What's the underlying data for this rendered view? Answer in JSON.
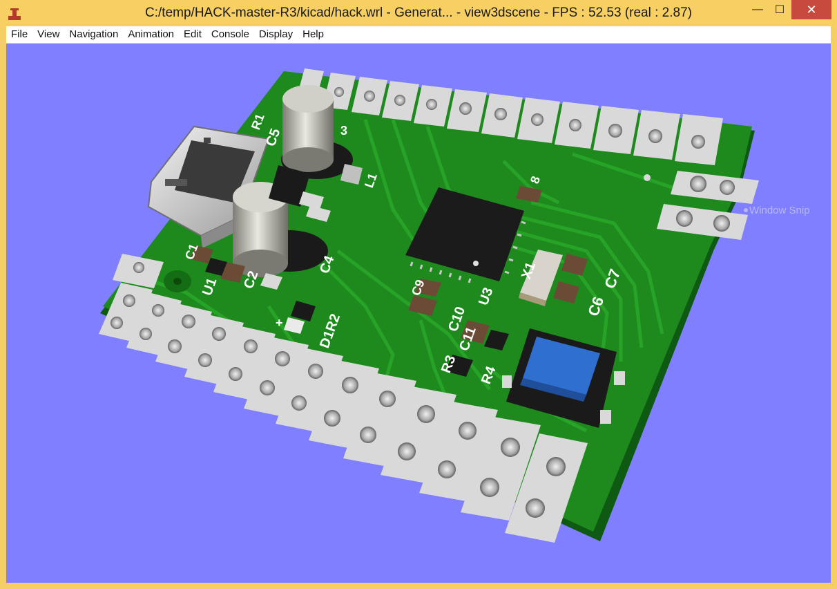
{
  "window": {
    "title": "C:/temp/HACK-master-R3/kicad/hack.wrl - Generat... - view3dscene - FPS : 52.53 (real : 2.87)",
    "min_glyph": "—",
    "max_glyph": "☐",
    "close_glyph": "✕"
  },
  "menu": {
    "items": [
      "File",
      "View",
      "Navigation",
      "Animation",
      "Edit",
      "Console",
      "Display",
      "Help"
    ]
  },
  "overlay": {
    "window_snip": "Window Snip"
  },
  "pcb": {
    "labels": {
      "c5": "C5",
      "r1": "R1",
      "c3": "3",
      "l1": "L1",
      "c8": "8",
      "c4": "C4",
      "c2": "C2",
      "u1": "U1",
      "c1": "C1",
      "c9": "C9",
      "c10": "C10",
      "c11": "C11",
      "u3": "U3",
      "x1": "X1",
      "c6": "C6",
      "c7": "C7",
      "d1r2": "D1R2",
      "r3": "R3",
      "r4": "R4",
      "plus": "+"
    }
  },
  "colors": {
    "viewport_bg": "#7f7fff",
    "pcb_green": "#1e8a1e",
    "trace_green": "#27a427",
    "titlebar": "#f7cf62",
    "close_red": "#c84a3e",
    "button_blue": "#2f6fd0"
  }
}
